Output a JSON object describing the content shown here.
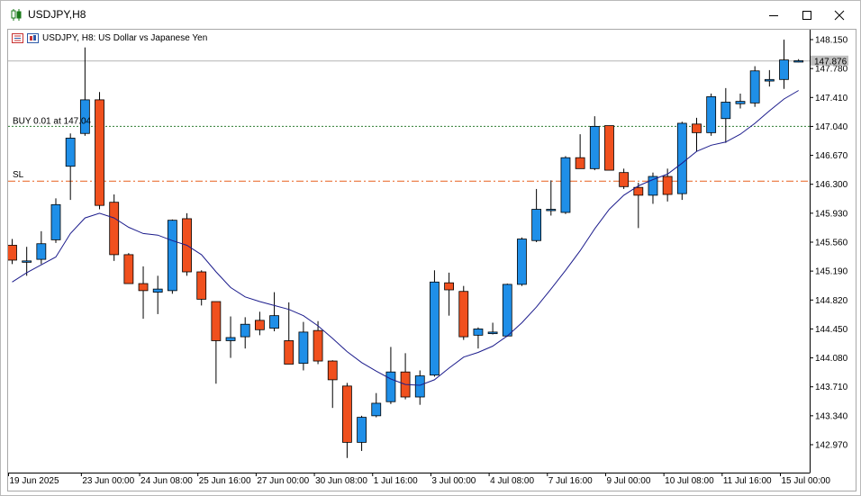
{
  "window": {
    "title": "USDJPY,H8",
    "controls": [
      "minimize-icon",
      "maximize-icon",
      "close-icon"
    ]
  },
  "chart_header": {
    "symbol_label": "USDJPY, H8:",
    "description": "US Dollar vs Japanese Yen"
  },
  "lines": {
    "buy_label": "BUY 0.01 at 147.04",
    "buy_price": 147.04,
    "sl_label": "SL",
    "sl_price": 146.34,
    "current_price": 147.876,
    "current_price_label": "147.876"
  },
  "colors": {
    "bull": "#1f8fe8",
    "bear": "#f0501e",
    "ma": "#1c1c8c",
    "buy_line": "#2e7d32",
    "sl_line": "#e8601e",
    "bid_line": "#b4b4b4"
  },
  "chart_data": {
    "type": "candlestick",
    "timeframe": "H8",
    "ylim": [
      142.65,
      148.3
    ],
    "y_ticks": [
      "148.150",
      "147.780",
      "147.410",
      "147.040",
      "146.670",
      "146.300",
      "145.930",
      "145.560",
      "145.190",
      "144.820",
      "144.450",
      "144.080",
      "143.710",
      "143.340",
      "142.970"
    ],
    "x_ticks": [
      {
        "label": "19 Jun 2025",
        "index": 0
      },
      {
        "label": "23 Jun 00:00",
        "index": 5
      },
      {
        "label": "24 Jun 08:00",
        "index": 9
      },
      {
        "label": "25 Jun 16:00",
        "index": 13
      },
      {
        "label": "27 Jun 00:00",
        "index": 17
      },
      {
        "label": "30 Jun 08:00",
        "index": 21
      },
      {
        "label": "1 Jul 16:00",
        "index": 25
      },
      {
        "label": "3 Jul 00:00",
        "index": 29
      },
      {
        "label": "4 Jul 08:00",
        "index": 33
      },
      {
        "label": "7 Jul 16:00",
        "index": 37
      },
      {
        "label": "9 Jul 00:00",
        "index": 41
      },
      {
        "label": "10 Jul 08:00",
        "index": 45
      },
      {
        "label": "11 Jul 16:00",
        "index": 49
      },
      {
        "label": "15 Jul 00:00",
        "index": 53
      }
    ],
    "candles": [
      {
        "o": 145.52,
        "h": 145.6,
        "l": 145.28,
        "c": 145.33
      },
      {
        "o": 145.32,
        "h": 145.5,
        "l": 145.13,
        "c": 145.32
      },
      {
        "o": 145.34,
        "h": 145.7,
        "l": 145.28,
        "c": 145.54
      },
      {
        "o": 145.59,
        "h": 146.12,
        "l": 145.55,
        "c": 146.04
      },
      {
        "o": 146.53,
        "h": 146.95,
        "l": 146.1,
        "c": 146.89
      },
      {
        "o": 146.95,
        "h": 148.05,
        "l": 146.92,
        "c": 147.38
      },
      {
        "o": 147.38,
        "h": 147.48,
        "l": 145.98,
        "c": 146.03
      },
      {
        "o": 146.07,
        "h": 146.17,
        "l": 145.32,
        "c": 145.4
      },
      {
        "o": 145.4,
        "h": 145.42,
        "l": 145.03,
        "c": 145.03
      },
      {
        "o": 145.03,
        "h": 145.25,
        "l": 144.58,
        "c": 144.94
      },
      {
        "o": 144.92,
        "h": 145.13,
        "l": 144.64,
        "c": 144.96
      },
      {
        "o": 144.94,
        "h": 145.85,
        "l": 144.9,
        "c": 145.84
      },
      {
        "o": 145.86,
        "h": 145.93,
        "l": 145.13,
        "c": 145.18
      },
      {
        "o": 145.18,
        "h": 145.2,
        "l": 144.75,
        "c": 144.83
      },
      {
        "o": 144.8,
        "h": 144.8,
        "l": 143.75,
        "c": 144.3
      },
      {
        "o": 144.3,
        "h": 144.61,
        "l": 144.08,
        "c": 144.34
      },
      {
        "o": 144.35,
        "h": 144.6,
        "l": 144.2,
        "c": 144.51
      },
      {
        "o": 144.56,
        "h": 144.67,
        "l": 144.37,
        "c": 144.44
      },
      {
        "o": 144.46,
        "h": 144.92,
        "l": 144.42,
        "c": 144.62
      },
      {
        "o": 144.3,
        "h": 144.79,
        "l": 144.0,
        "c": 144.0
      },
      {
        "o": 144.01,
        "h": 144.54,
        "l": 143.92,
        "c": 144.41
      },
      {
        "o": 144.43,
        "h": 144.55,
        "l": 144.0,
        "c": 144.04
      },
      {
        "o": 144.04,
        "h": 144.05,
        "l": 143.44,
        "c": 143.8
      },
      {
        "o": 143.72,
        "h": 143.76,
        "l": 142.8,
        "c": 143.0
      },
      {
        "o": 143.0,
        "h": 143.34,
        "l": 142.89,
        "c": 143.32
      },
      {
        "o": 143.34,
        "h": 143.63,
        "l": 143.32,
        "c": 143.5
      },
      {
        "o": 143.52,
        "h": 144.22,
        "l": 143.49,
        "c": 143.9
      },
      {
        "o": 143.9,
        "h": 144.14,
        "l": 143.55,
        "c": 143.58
      },
      {
        "o": 143.58,
        "h": 143.92,
        "l": 143.48,
        "c": 143.85
      },
      {
        "o": 143.86,
        "h": 145.2,
        "l": 143.84,
        "c": 145.05
      },
      {
        "o": 145.04,
        "h": 145.17,
        "l": 144.62,
        "c": 144.95
      },
      {
        "o": 144.93,
        "h": 145.0,
        "l": 144.31,
        "c": 144.35
      },
      {
        "o": 144.37,
        "h": 144.47,
        "l": 144.2,
        "c": 144.45
      },
      {
        "o": 144.39,
        "h": 144.53,
        "l": 144.38,
        "c": 144.41
      },
      {
        "o": 144.36,
        "h": 145.03,
        "l": 144.35,
        "c": 145.02
      },
      {
        "o": 145.02,
        "h": 145.62,
        "l": 145.0,
        "c": 145.6
      },
      {
        "o": 145.58,
        "h": 146.24,
        "l": 145.56,
        "c": 145.98
      },
      {
        "o": 145.97,
        "h": 146.35,
        "l": 145.9,
        "c": 145.98
      },
      {
        "o": 145.94,
        "h": 146.66,
        "l": 145.92,
        "c": 146.64
      },
      {
        "o": 146.64,
        "h": 146.94,
        "l": 146.5,
        "c": 146.5
      },
      {
        "o": 146.5,
        "h": 147.17,
        "l": 146.48,
        "c": 147.04
      },
      {
        "o": 147.05,
        "h": 147.05,
        "l": 146.48,
        "c": 146.48
      },
      {
        "o": 146.45,
        "h": 146.5,
        "l": 146.24,
        "c": 146.27
      },
      {
        "o": 146.26,
        "h": 146.32,
        "l": 145.74,
        "c": 146.16
      },
      {
        "o": 146.16,
        "h": 146.45,
        "l": 146.05,
        "c": 146.4
      },
      {
        "o": 146.4,
        "h": 146.5,
        "l": 146.08,
        "c": 146.17
      },
      {
        "o": 146.18,
        "h": 147.1,
        "l": 146.1,
        "c": 147.08
      },
      {
        "o": 147.07,
        "h": 147.15,
        "l": 146.72,
        "c": 146.96
      },
      {
        "o": 146.96,
        "h": 147.46,
        "l": 146.92,
        "c": 147.42
      },
      {
        "o": 147.14,
        "h": 147.53,
        "l": 146.83,
        "c": 147.35
      },
      {
        "o": 147.33,
        "h": 147.46,
        "l": 147.27,
        "c": 147.36
      },
      {
        "o": 147.34,
        "h": 147.81,
        "l": 147.29,
        "c": 147.75
      },
      {
        "o": 147.62,
        "h": 147.76,
        "l": 147.55,
        "c": 147.64
      },
      {
        "o": 147.64,
        "h": 148.15,
        "l": 147.52,
        "c": 147.89
      },
      {
        "o": 147.88,
        "h": 147.9,
        "l": 147.86,
        "c": 147.88
      }
    ],
    "ma": [
      145.05,
      145.17,
      145.27,
      145.37,
      145.67,
      145.87,
      145.93,
      145.87,
      145.75,
      145.67,
      145.65,
      145.58,
      145.52,
      145.4,
      145.18,
      144.98,
      144.86,
      144.8,
      144.75,
      144.7,
      144.62,
      144.49,
      144.33,
      144.16,
      144.02,
      143.91,
      143.81,
      143.74,
      143.73,
      143.8,
      143.95,
      144.09,
      144.15,
      144.23,
      144.36,
      144.53,
      144.73,
      144.96,
      145.2,
      145.45,
      145.73,
      145.98,
      146.16,
      146.28,
      146.36,
      146.43,
      146.57,
      146.72,
      146.8,
      146.84,
      146.94,
      147.08,
      147.24,
      147.39,
      147.5
    ]
  }
}
